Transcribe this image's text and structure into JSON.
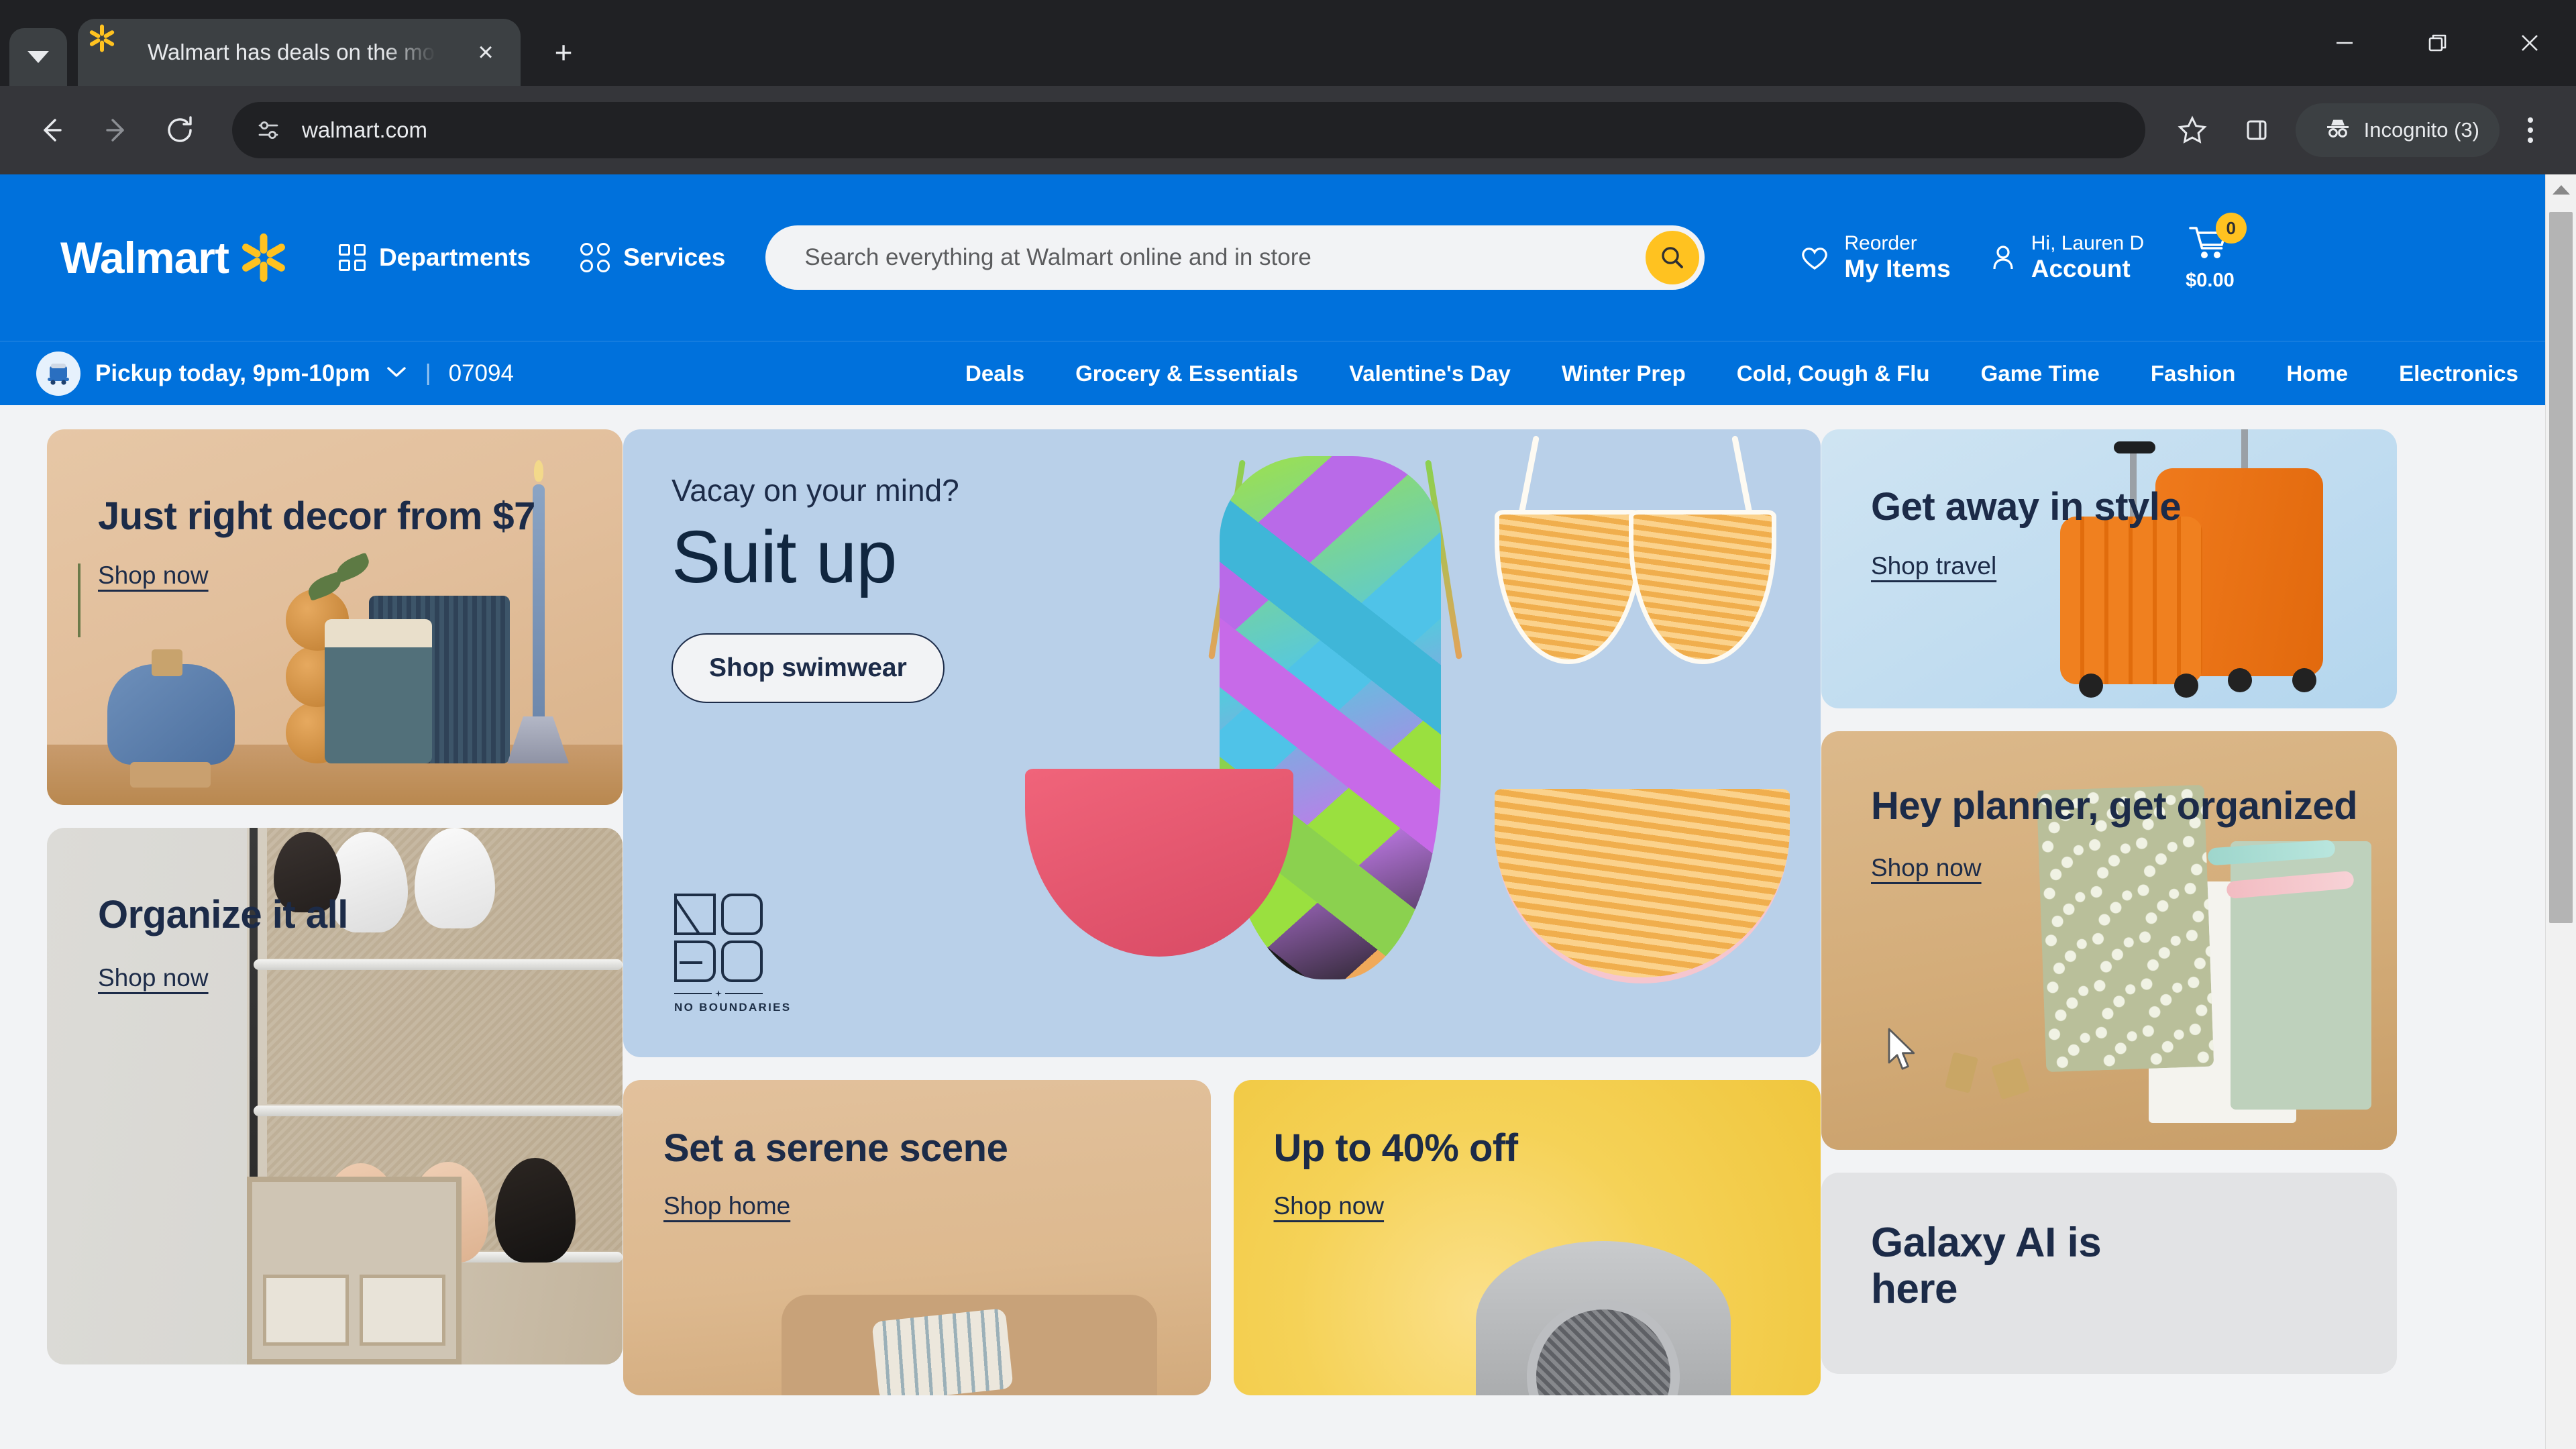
{
  "browser": {
    "tab": {
      "title": "Walmart has deals on the most",
      "favicon": "walmart-spark-icon",
      "close": "×"
    },
    "new_tab_label": "+",
    "window_controls": {
      "minimize": "–",
      "maximize": "❐",
      "close": "✕"
    },
    "toolbar": {
      "back": "←",
      "forward": "→",
      "reload": "↻",
      "url": "walmart.com",
      "site_info": "tune-icon",
      "bookmark": "star-icon",
      "side_panel": "side-panel-icon",
      "profile_label": "Incognito (3)",
      "menu": "kebab-menu-icon"
    }
  },
  "site": {
    "brand": "Walmart",
    "header": {
      "departments": "Departments",
      "services": "Services",
      "search_placeholder": "Search everything at Walmart online and in store",
      "search_value": "",
      "reorder_top": "Reorder",
      "reorder_bottom": "My Items",
      "account_top": "Hi, Lauren D",
      "account_bottom": "Account",
      "cart_count": "0",
      "cart_total": "$0.00"
    },
    "nav": {
      "pickup_label": "Pickup today, 9pm-10pm",
      "divider": "|",
      "zip": "07094",
      "links": [
        "Deals",
        "Grocery & Essentials",
        "Valentine's Day",
        "Winter Prep",
        "Cold, Cough & Flu",
        "Game Time",
        "Fashion",
        "Home",
        "Electronics"
      ]
    },
    "cards": {
      "decor": {
        "title": "Just right decor from $7",
        "link": "Shop now"
      },
      "organize": {
        "title": "Organize it all",
        "link": "Shop now"
      },
      "hero": {
        "kicker": "Vacay on your mind?",
        "title": "Suit up",
        "button": "Shop swimwear",
        "brand_logo": "NOBO",
        "brand_sub": "NO BOUNDARIES"
      },
      "serene": {
        "title": "Set a serene scene",
        "link": "Shop home"
      },
      "sale": {
        "title": "Up to 40% off",
        "link": "Shop now"
      },
      "travel": {
        "title": "Get away in style",
        "link": "Shop travel"
      },
      "planner": {
        "title": "Hey planner, get organized",
        "link": "Shop now"
      },
      "galaxy": {
        "title": "Galaxy AI is here"
      }
    }
  },
  "colors": {
    "walmart_blue": "#0071dc",
    "walmart_yellow": "#ffc220",
    "ink": "#1c2b48",
    "page_bg": "#f2f3f5"
  }
}
